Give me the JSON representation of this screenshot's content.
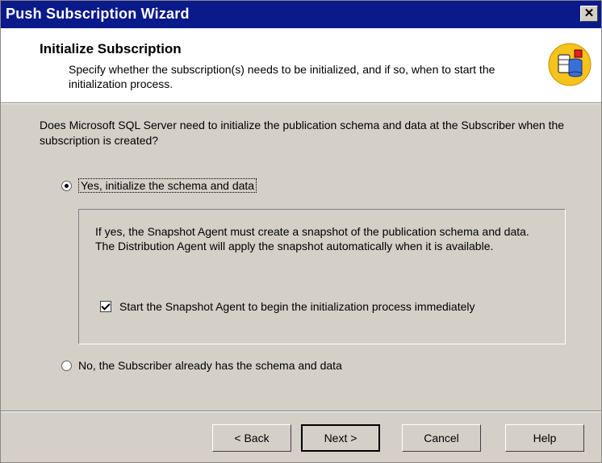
{
  "window": {
    "title": "Push Subscription Wizard",
    "close_glyph": "✕"
  },
  "header": {
    "title": "Initialize Subscription",
    "description": "Specify whether the subscription(s) needs to be initialized, and if so, when to start the initialization process.",
    "icon": "database-wizard-icon"
  },
  "main": {
    "question": "Does Microsoft SQL Server need to initialize the publication schema and data at the Subscriber when the subscription is created?",
    "radio_yes": {
      "label": "Yes, initialize the schema and data",
      "selected": true
    },
    "group": {
      "text": "If yes, the Snapshot Agent must create a snapshot of the publication schema and data. The Distribution Agent will apply the snapshot automatically when it is available.",
      "checkbox": {
        "label": "Start the Snapshot Agent to begin the initialization process immediately",
        "checked": true
      }
    },
    "radio_no": {
      "label": "No, the Subscriber already has the schema and data",
      "selected": false
    }
  },
  "footer": {
    "back": "< Back",
    "next": "Next >",
    "cancel": "Cancel",
    "help": "Help"
  }
}
